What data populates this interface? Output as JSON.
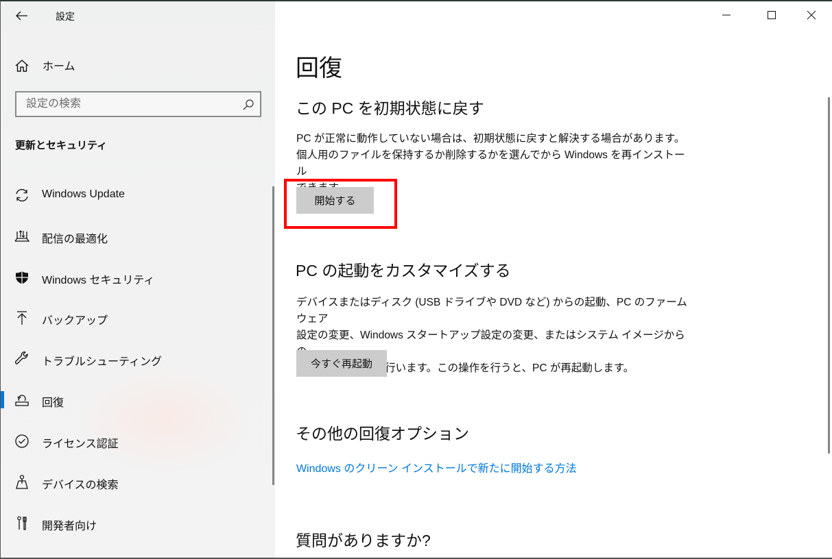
{
  "window": {
    "title": "設定",
    "controls": {
      "minimize": "minimize",
      "maximize": "maximize",
      "close": "close"
    }
  },
  "sidebar": {
    "home_label": "ホーム",
    "search_placeholder": "設定の検索",
    "section_title": "更新とセキュリティ",
    "items": [
      {
        "label": "Windows Update",
        "icon": "sync-icon"
      },
      {
        "label": "配信の最適化",
        "icon": "delivery-optimization-icon"
      },
      {
        "label": "Windows セキュリティ",
        "icon": "shield-icon"
      },
      {
        "label": "バックアップ",
        "icon": "backup-arrow-icon"
      },
      {
        "label": "トラブルシューティング",
        "icon": "wrench-icon"
      },
      {
        "label": "回復",
        "icon": "recovery-icon",
        "selected": true
      },
      {
        "label": "ライセンス認証",
        "icon": "check-circle-icon"
      },
      {
        "label": "デバイスの検索",
        "icon": "find-device-icon"
      },
      {
        "label": "開発者向け",
        "icon": "developer-tools-icon"
      }
    ],
    "accent_color": "#0078d7"
  },
  "main": {
    "page_title": "回復",
    "sections": [
      {
        "title": "この PC を初期状態に戻す",
        "description_lines": [
          "PC が正常に動作していない場合は、初期状態に戻すと解決する場合があります。",
          "個人用のファイルを保持するか削除するかを選んでから Windows を再インストール",
          "できます。"
        ],
        "button_label": "開始する",
        "highlighted": true
      },
      {
        "title": "PC の起動をカスタマイズする",
        "description_lines": [
          "デバイスまたはディスク (USB ドライブや DVD など) からの起動、PC のファームウェア",
          "設定の変更、Windows スタートアップ設定の変更、またはシステム イメージからの",
          "Windows の復元を行います。この操作を行うと、PC が再起動します。"
        ],
        "button_label": "今すぐ再起動"
      },
      {
        "title": "その他の回復オプション",
        "link_label": "Windows のクリーン インストールで新たに開始する方法"
      },
      {
        "title": "質問がありますか?"
      }
    ],
    "link_color": "#0078d7",
    "highlight_color": "#ff0000",
    "button_color": "#cccccc"
  }
}
